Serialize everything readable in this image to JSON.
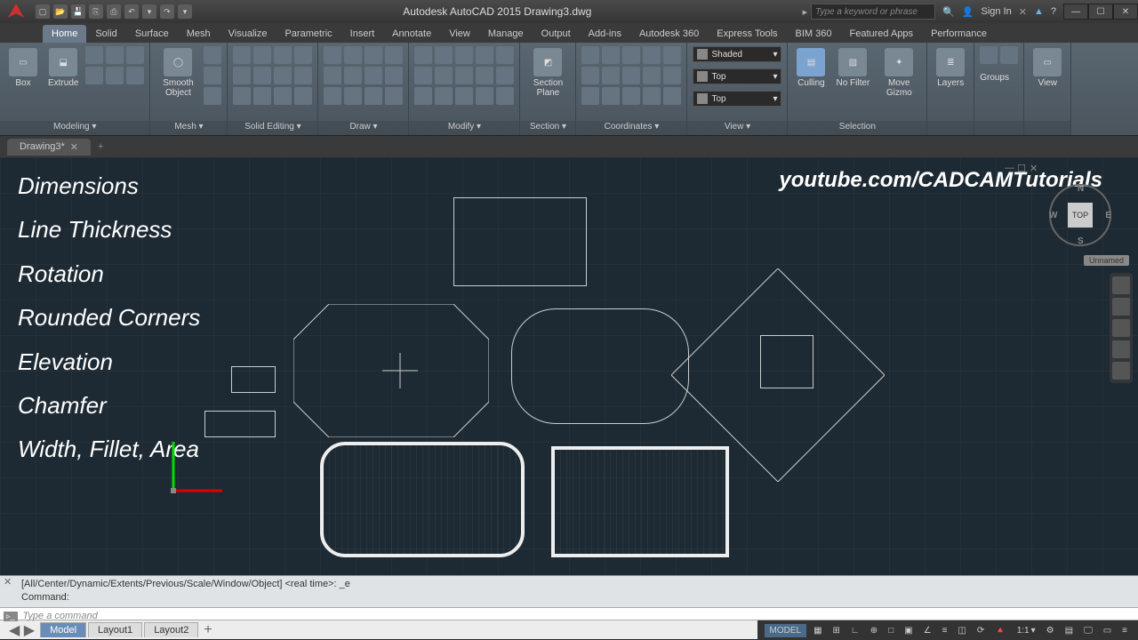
{
  "title": "Autodesk AutoCAD 2015   Drawing3.dwg",
  "search_placeholder": "Type a keyword or phrase",
  "sign_in": "Sign In",
  "tabs": [
    "Home",
    "Solid",
    "Surface",
    "Mesh",
    "Visualize",
    "Parametric",
    "Insert",
    "Annotate",
    "View",
    "Manage",
    "Output",
    "Add-ins",
    "Autodesk 360",
    "Express Tools",
    "BIM 360",
    "Featured Apps",
    "Performance"
  ],
  "active_tab": "Home",
  "panels": {
    "modeling": {
      "label": "Modeling ▾",
      "btns": [
        "Box",
        "Extrude"
      ]
    },
    "mesh": {
      "label": "Mesh ▾",
      "btn": "Smooth Object"
    },
    "solid_edit": {
      "label": "Solid Editing ▾"
    },
    "draw": {
      "label": "Draw ▾"
    },
    "modify": {
      "label": "Modify ▾"
    },
    "section": {
      "label": "Section ▾",
      "btn": "Section Plane"
    },
    "coords": {
      "label": "Coordinates ▾"
    },
    "view": {
      "label": "View ▾",
      "shaded": "Shaded",
      "top1": "Top",
      "top2": "Top"
    },
    "selection": {
      "label": "Selection",
      "btns": [
        "Culling",
        "No Filter",
        "Move Gizmo"
      ]
    },
    "layers": {
      "label": "",
      "btn": "Layers"
    },
    "groups": {
      "label": "",
      "btn": "Groups"
    },
    "viewpanel": {
      "label": "",
      "btn": "View"
    }
  },
  "drawing_tab": "Drawing3*",
  "overlay_items": [
    "Dimensions",
    "Line Thickness",
    "Rotation",
    "Rounded Corners",
    "Elevation",
    "Chamfer",
    "Width, Fillet, Area"
  ],
  "brand": "youtube.com/CADCAMTutorials",
  "viewcube": "TOP",
  "unnamed": "Unnamed",
  "cmd_history": "[All/Center/Dynamic/Extents/Previous/Scale/Window/Object] <real time>: _e",
  "cmd_history2": "Command:",
  "cmd_prompt": "Type a command",
  "layout_tabs": [
    "Model",
    "Layout1",
    "Layout2"
  ],
  "status": {
    "model": "MODEL",
    "scale": "1:1"
  }
}
